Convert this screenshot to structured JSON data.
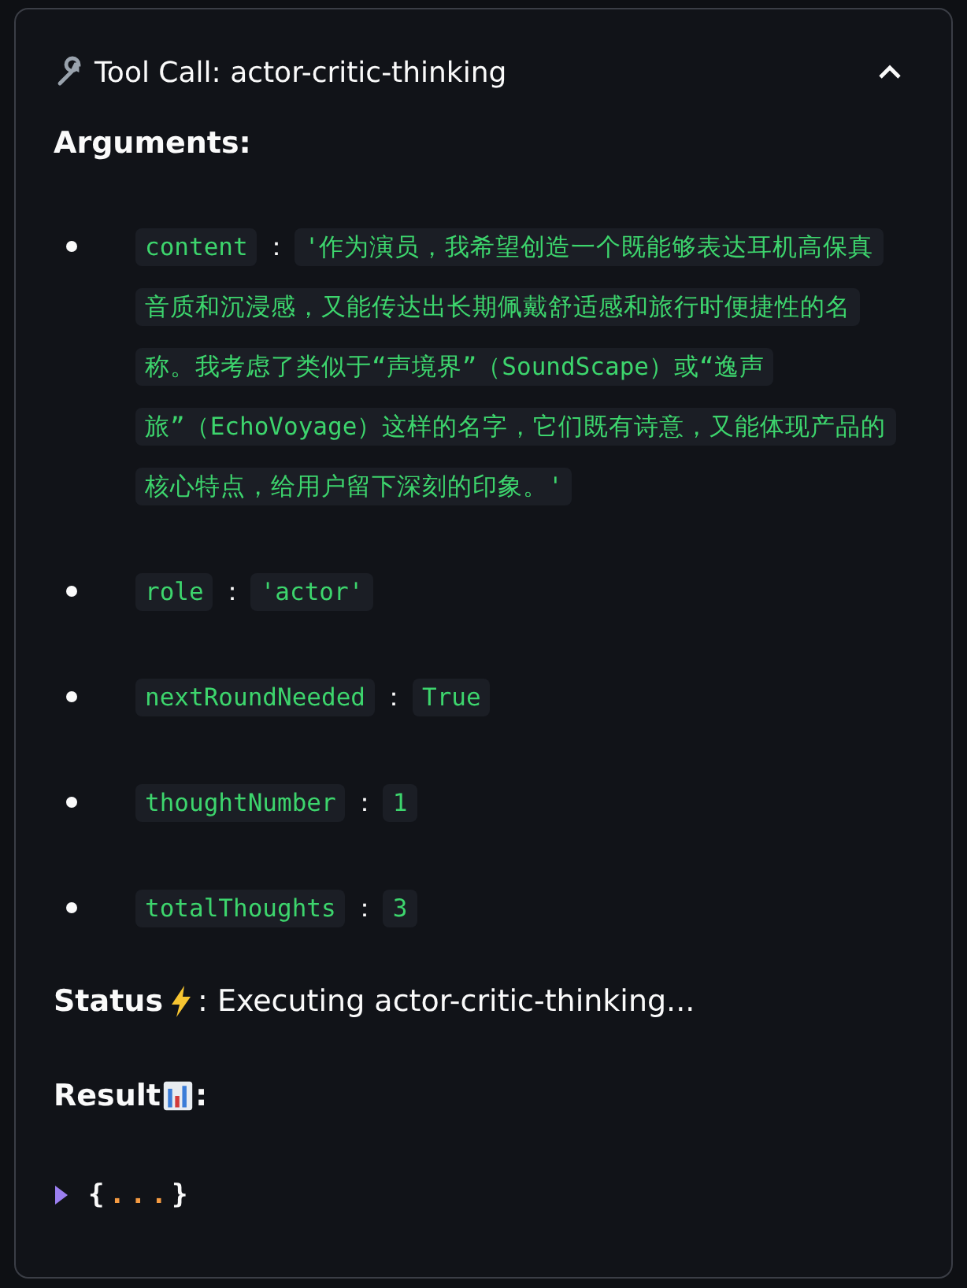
{
  "tool_call": {
    "title": "Tool Call: actor-critic-thinking",
    "expanded": true,
    "arguments_heading": "Arguments:",
    "arguments": [
      {
        "key": "content",
        "separator": "：",
        "value": "'作为演员，我希望创造一个既能够表达耳机高保真音质和沉浸感，又能传达出长期佩戴舒适感和旅行时便捷性的名称。我考虑了类似于“声境界”（SoundScape）或“逸声旅”（EchoVoyage）这样的名字，它们既有诗意，又能体现产品的核心特点，给用户留下深刻的印象。'"
      },
      {
        "key": "role",
        "separator": "：",
        "value": "'actor'"
      },
      {
        "key": "nextRoundNeeded",
        "separator": "：",
        "value": "True"
      },
      {
        "key": "thoughtNumber",
        "separator": "：",
        "value": "1"
      },
      {
        "key": "totalThoughts",
        "separator": "：",
        "value": "3"
      }
    ],
    "status": {
      "label": "Status",
      "text": ": Executing actor-critic-thinking..."
    },
    "result": {
      "label": "Result",
      "suffix": ":",
      "expanded": false,
      "open": "{",
      "ellipsis": "...",
      "close": "}"
    }
  }
}
